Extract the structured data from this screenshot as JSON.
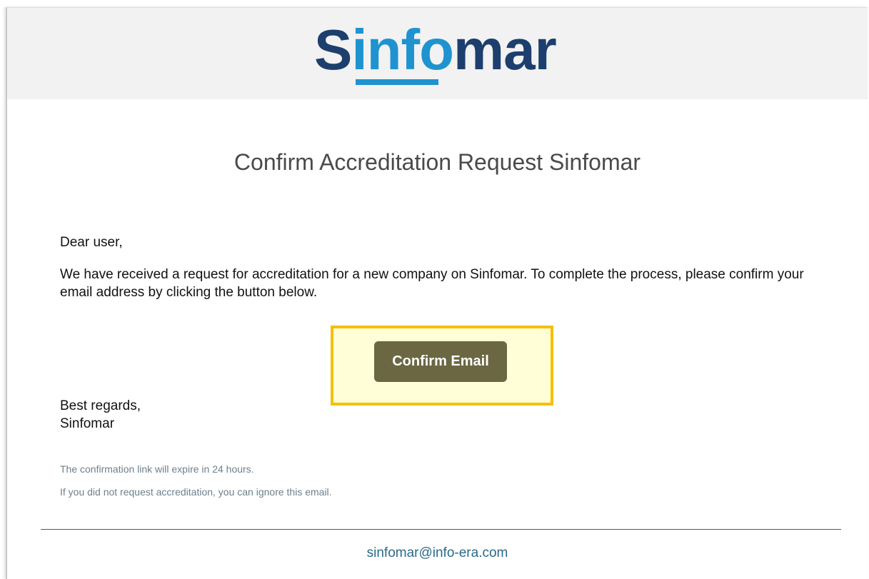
{
  "brand": {
    "logo_text": "Sinfomar",
    "colors": {
      "navy": "#1d3f6e",
      "blue": "#1f93cf",
      "underline": "#1f93cf"
    }
  },
  "email": {
    "title": "Confirm Accreditation Request Sinfomar",
    "greeting": "Dear user,",
    "paragraph": "We have received a request for accreditation for a new company on Sinfomar. To complete the process, please confirm your email address by clicking the button below.",
    "button_label": "Confirm Email",
    "button_color": "#6b6743",
    "highlight_border_color": "#f5c000",
    "highlight_fill_color": "#fffed6",
    "regards_line1": "Best regards,",
    "regards_line2": "Sinfomar",
    "note_expiry": "The confirmation link will expire in 24 hours.",
    "note_ignore": "If you did not request accreditation, you can ignore this email."
  },
  "footer": {
    "contact_email": "sinfomar@info-era.com"
  }
}
